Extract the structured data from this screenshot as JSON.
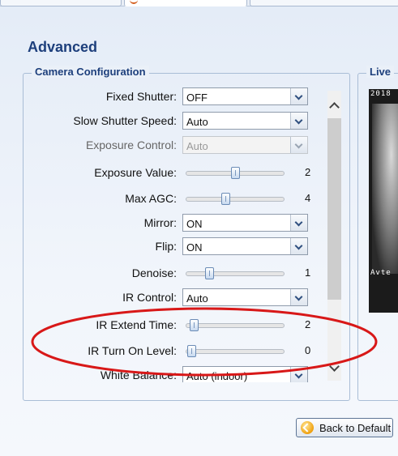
{
  "page": {
    "title": "Advanced"
  },
  "camera_config": {
    "legend": "Camera Configuration",
    "fixed_shutter": {
      "label": "Fixed Shutter:",
      "value": "OFF"
    },
    "slow_shutter_speed": {
      "label": "Slow Shutter Speed:",
      "value": "Auto"
    },
    "exposure_control": {
      "label": "Exposure Control:",
      "value": "Auto",
      "disabled": true
    },
    "exposure_value": {
      "label": "Exposure Value:",
      "value": "2",
      "level": 0.5
    },
    "max_agc": {
      "label": "Max AGC:",
      "value": "4",
      "level": 0.4
    },
    "mirror": {
      "label": "Mirror:",
      "value": "ON"
    },
    "flip": {
      "label": "Flip:",
      "value": "ON"
    },
    "denoise": {
      "label": "Denoise:",
      "value": "1",
      "level": 0.24
    },
    "ir_control": {
      "label": "IR Control:",
      "value": "Auto"
    },
    "ir_extend_time": {
      "label": "IR Extend Time:",
      "value": "2",
      "level": 0.08
    },
    "ir_turn_on_level": {
      "label": "IR Turn On Level:",
      "value": "0",
      "level": 0.06
    },
    "white_balance": {
      "label": "White Balance:",
      "value": "Auto (indoor)"
    }
  },
  "live": {
    "legend": "Live",
    "timestamp": "2018",
    "camera_name": "Avte"
  },
  "buttons": {
    "back_to_default": "Back to Default"
  },
  "colors": {
    "accent": "#1d3f7c",
    "annotation": "#d81818"
  },
  "icons": {
    "scroll_up": "chevron-up-icon",
    "scroll_down": "chevron-down-icon",
    "back": "undo-arrow-icon"
  }
}
